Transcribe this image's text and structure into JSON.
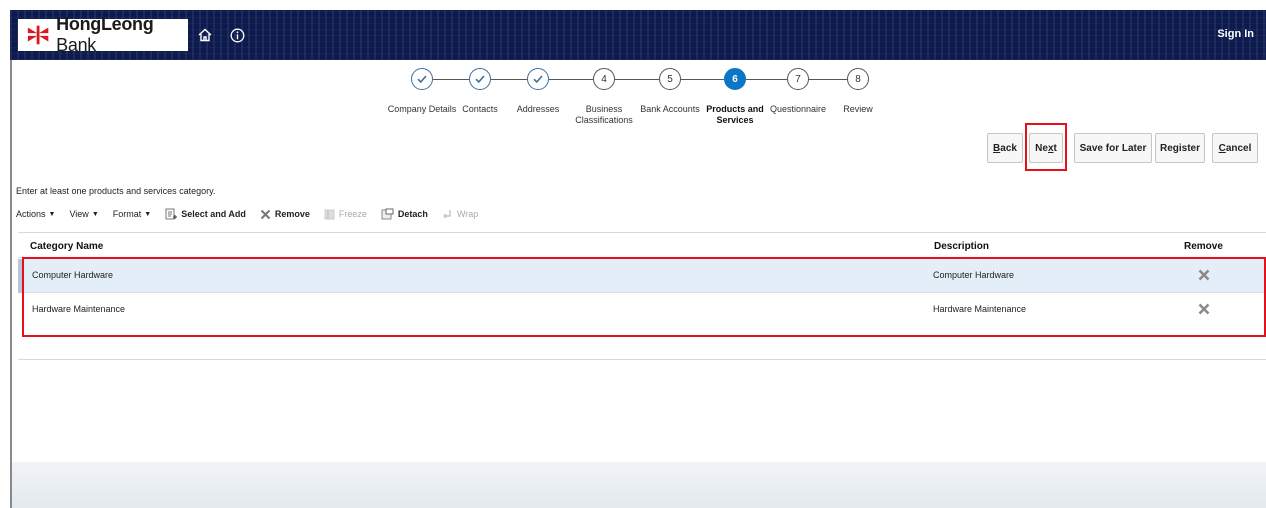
{
  "header": {
    "brand_bold": "HongLeong",
    "brand_light": " Bank",
    "sign_in": "Sign In",
    "icons": [
      "home-icon",
      "info-icon"
    ],
    "colors": {
      "band": "#0d1a4a",
      "logo_red": "#d71920",
      "current_step": "#0a76c4",
      "highlight": "#e4101c"
    }
  },
  "train": {
    "steps": [
      {
        "num": "1",
        "label": "Company Details",
        "state": "done"
      },
      {
        "num": "2",
        "label": "Contacts",
        "state": "done"
      },
      {
        "num": "3",
        "label": "Addresses",
        "state": "done"
      },
      {
        "num": "4",
        "label": "Business Classifications",
        "state": "pending"
      },
      {
        "num": "5",
        "label": "Bank Accounts",
        "state": "pending"
      },
      {
        "num": "6",
        "label": "Products and Services",
        "state": "current"
      },
      {
        "num": "7",
        "label": "Questionnaire",
        "state": "pending"
      },
      {
        "num": "8",
        "label": "Review",
        "state": "pending"
      }
    ]
  },
  "buttons": {
    "back_pre": "",
    "back_u": "B",
    "back_post": "ack",
    "next_pre": "Ne",
    "next_u": "x",
    "next_post": "t",
    "save_for_later": "Save for Later",
    "register": "Register",
    "cancel_pre": "",
    "cancel_u": "C",
    "cancel_post": "ancel"
  },
  "instruction": "Enter at least one products and services category.",
  "toolbar": {
    "actions": "Actions",
    "view": "View",
    "format": "Format",
    "select_and_add": "Select and Add",
    "remove": "Remove",
    "freeze": "Freeze",
    "detach": "Detach",
    "wrap": "Wrap"
  },
  "table": {
    "headers": {
      "category": "Category Name",
      "description": "Description",
      "remove": "Remove"
    },
    "rows": [
      {
        "category": "Computer Hardware",
        "description": "Computer Hardware",
        "selected": true
      },
      {
        "category": "Hardware Maintenance",
        "description": "Hardware Maintenance",
        "selected": false
      }
    ]
  }
}
